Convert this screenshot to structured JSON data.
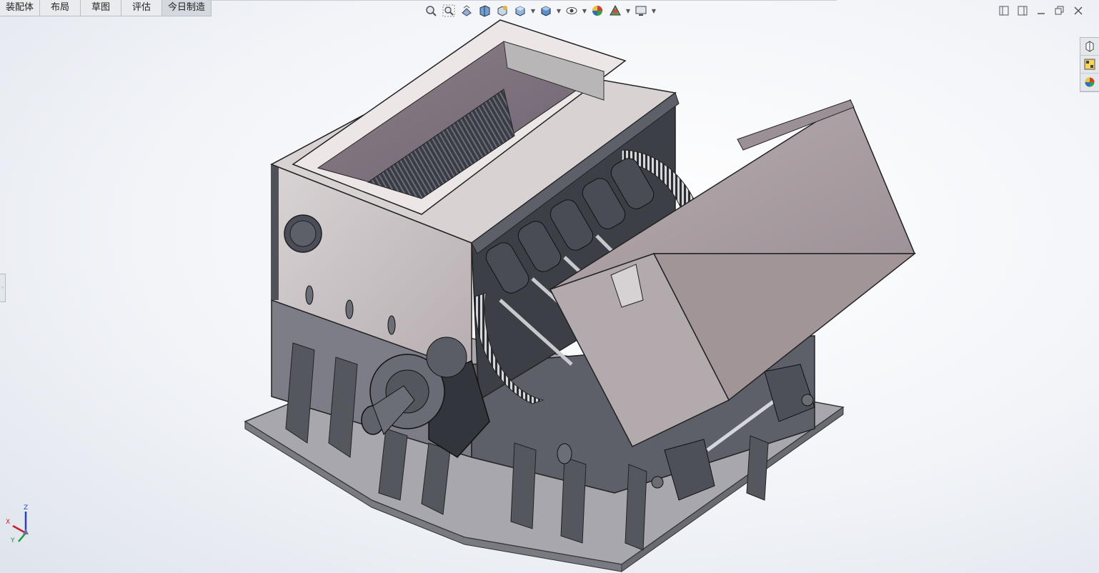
{
  "command_tabs": [
    {
      "label": "装配体",
      "active": false
    },
    {
      "label": "布局",
      "active": false
    },
    {
      "label": "草图",
      "active": false
    },
    {
      "label": "评估",
      "active": false
    },
    {
      "label": "今日制造",
      "active": true
    }
  ],
  "hud_toolbar": {
    "icons": [
      "zoom-to-fit-icon",
      "zoom-to-area-icon",
      "previous-view-icon",
      "section-view-icon",
      "dynamic-annotation-icon",
      "view-orientation-icon",
      "display-style-icon",
      "hide-show-icon",
      "edit-appearance-icon",
      "apply-scene-icon",
      "view-settings-icon"
    ]
  },
  "triad": {
    "x": "X",
    "y": "Y",
    "z": "Z"
  },
  "colors": {
    "accent_blue": "#2f6db5",
    "triad_x": "#c0202a",
    "triad_y": "#1f9a2f",
    "triad_z": "#2a3fc8",
    "steel_dark": "#4a4d57",
    "steel_mid": "#6f717c",
    "steel_light": "#c9c8cc",
    "plate_face": "#bdb4b6",
    "plate_inner": "#8a8088"
  }
}
